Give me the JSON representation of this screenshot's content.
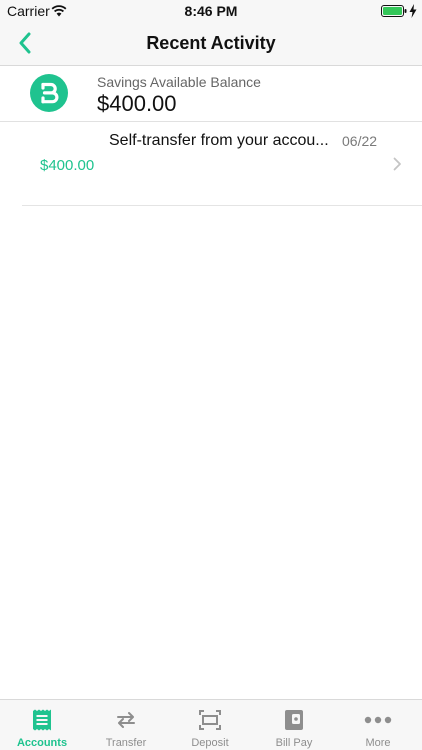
{
  "status_bar": {
    "carrier": "Carrier",
    "time": "8:46 PM"
  },
  "nav": {
    "title": "Recent Activity",
    "back_icon": "chevron-left-icon"
  },
  "account": {
    "logo_icon": "bank-logo-icon",
    "balance_label": "Savings Available Balance",
    "balance_amount": "$400.00"
  },
  "transactions": [
    {
      "description": "Self-transfer from your accou...",
      "date": "06/22",
      "amount": "$400.00"
    }
  ],
  "tabs": [
    {
      "label": "Accounts",
      "icon": "accounts-icon",
      "active": true
    },
    {
      "label": "Transfer",
      "icon": "transfer-icon",
      "active": false
    },
    {
      "label": "Deposit",
      "icon": "deposit-icon",
      "active": false
    },
    {
      "label": "Bill Pay",
      "icon": "bill-pay-icon",
      "active": false
    },
    {
      "label": "More",
      "icon": "more-icon",
      "active": false
    }
  ],
  "colors": {
    "accent": "#1fc38f",
    "inactive": "#8e8e8e",
    "bar_background": "#f7f7f7"
  }
}
